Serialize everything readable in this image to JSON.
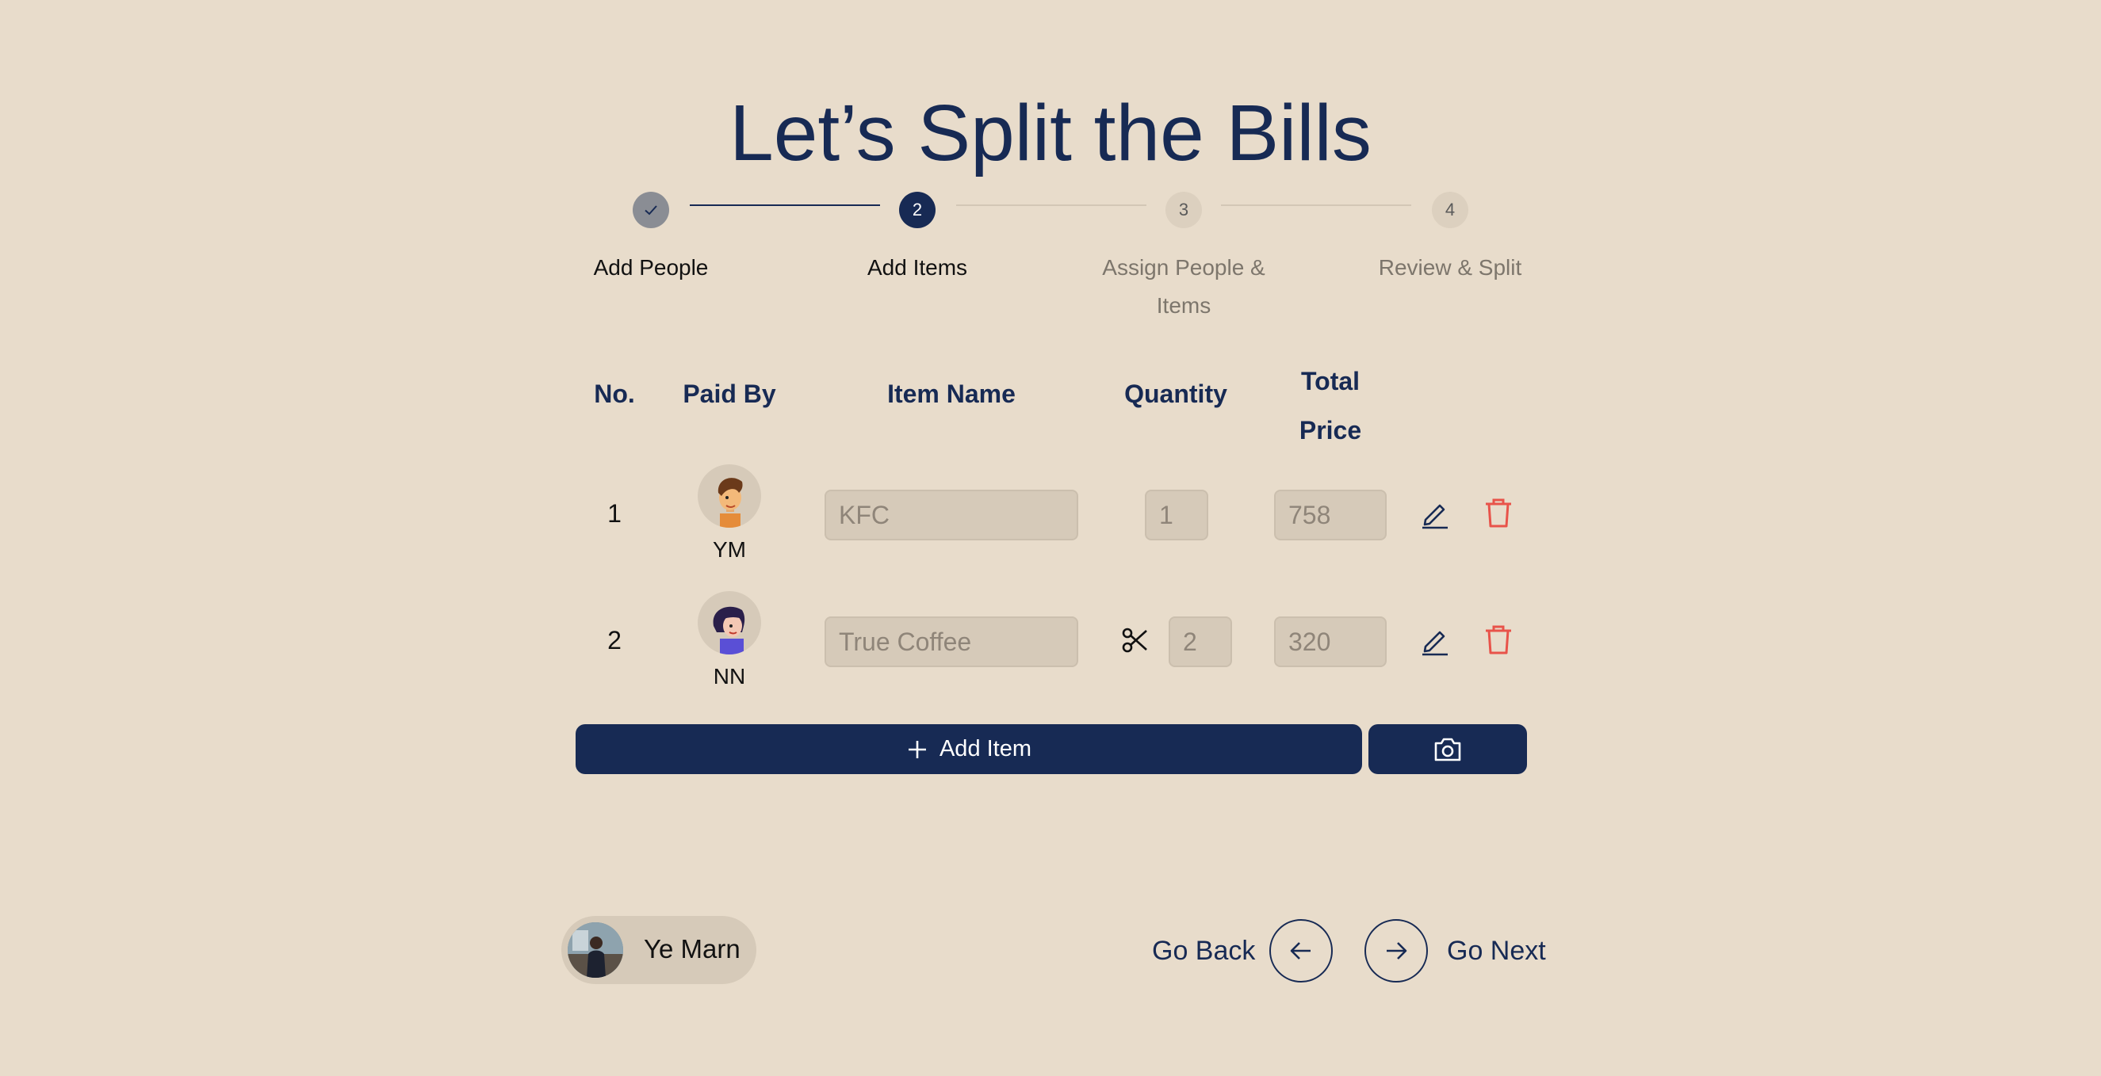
{
  "page": {
    "title": "Let’s Split the Bills"
  },
  "stepper": {
    "steps": [
      {
        "number": "1",
        "label": "Add People",
        "state": "completed"
      },
      {
        "number": "2",
        "label": "Add Items",
        "state": "active"
      },
      {
        "number": "3",
        "label": "Assign People & Items",
        "state": "pending"
      },
      {
        "number": "4",
        "label": "Review & Split",
        "state": "pending"
      }
    ]
  },
  "table": {
    "headers": {
      "no": "No.",
      "paid_by": "Paid By",
      "item_name": "Item Name",
      "quantity": "Quantity",
      "total_price": "Total Price"
    },
    "rows": [
      {
        "no": "1",
        "payer": "YM",
        "item_name": "KFC",
        "quantity": "1",
        "total_price": "758",
        "split_icon": ""
      },
      {
        "no": "2",
        "payer": "NN",
        "item_name": "True Coffee",
        "quantity": "2",
        "total_price": "320",
        "split_icon": "scissors-icon"
      }
    ]
  },
  "actions": {
    "add_item_label": "Add Item",
    "camera_icon": "camera-icon"
  },
  "footer": {
    "user_name": "Ye Marn",
    "go_back_label": "Go Back",
    "go_next_label": "Go Next"
  },
  "colors": {
    "background": "#e8dccb",
    "primary": "#172a54",
    "field": "#d6cab9",
    "delete": "#e8534a",
    "completed_step": "#8a8d94"
  }
}
